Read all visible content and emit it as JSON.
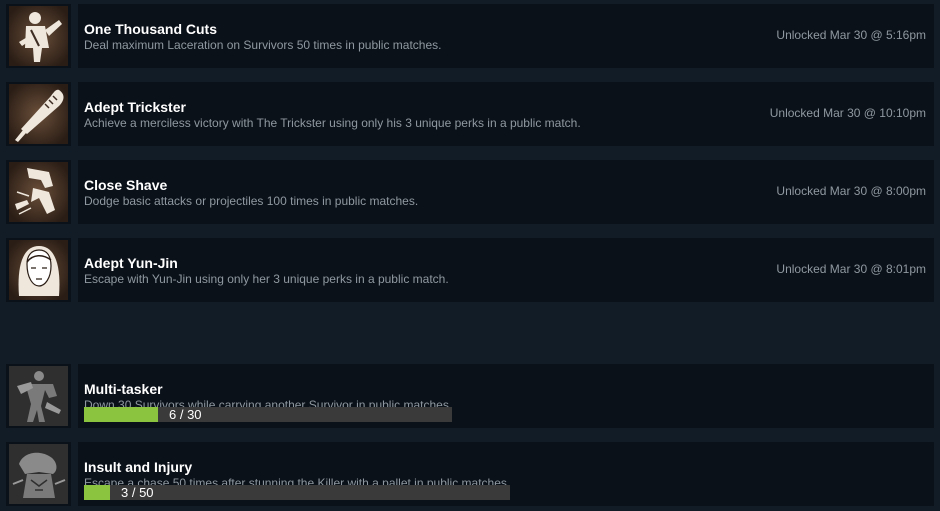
{
  "unlocked": [
    {
      "icon": "cleaver-killer-icon",
      "title": "One Thousand Cuts",
      "description": "Deal maximum Laceration on Survivors 50 times in public matches.",
      "unlocked": "Unlocked Mar 30 @ 5:16pm"
    },
    {
      "icon": "baseball-bat-icon",
      "title": "Adept Trickster",
      "description": "Achieve a merciless victory with The Trickster using only his 3 unique perks in a public match.",
      "unlocked": "Unlocked Mar 30 @ 10:10pm"
    },
    {
      "icon": "dodging-survivor-icon",
      "title": "Close Shave",
      "description": "Dodge basic attacks or projectiles 100 times in public matches.",
      "unlocked": "Unlocked Mar 30 @ 8:00pm"
    },
    {
      "icon": "yun-jin-portrait-icon",
      "title": "Adept Yun-Jin",
      "description": "Escape with Yun-Jin using only her 3 unique perks in a public match.",
      "unlocked": "Unlocked Mar 30 @ 8:01pm"
    }
  ],
  "locked": [
    {
      "icon": "carrying-survivor-icon",
      "title": "Multi-tasker",
      "description": "Down 30 Survivors while carrying another Survivor in public matches.",
      "progress_text": "6 / 30",
      "progress_fraction": 0.2
    },
    {
      "icon": "stunned-killer-icon",
      "title": "Insult and Injury",
      "description": "Escape a chase 50 times after stunning the Killer with a pallet in public matches.",
      "progress_text": "3 / 50",
      "progress_fraction": 0.06
    }
  ],
  "colors": {
    "page_background": "#111c26",
    "row_background": "#0b1119",
    "title_text": "#ffffff",
    "secondary_text": "#8f98a0",
    "progress_fill": "#8bc53f",
    "progress_track": "#3a3a3a"
  }
}
